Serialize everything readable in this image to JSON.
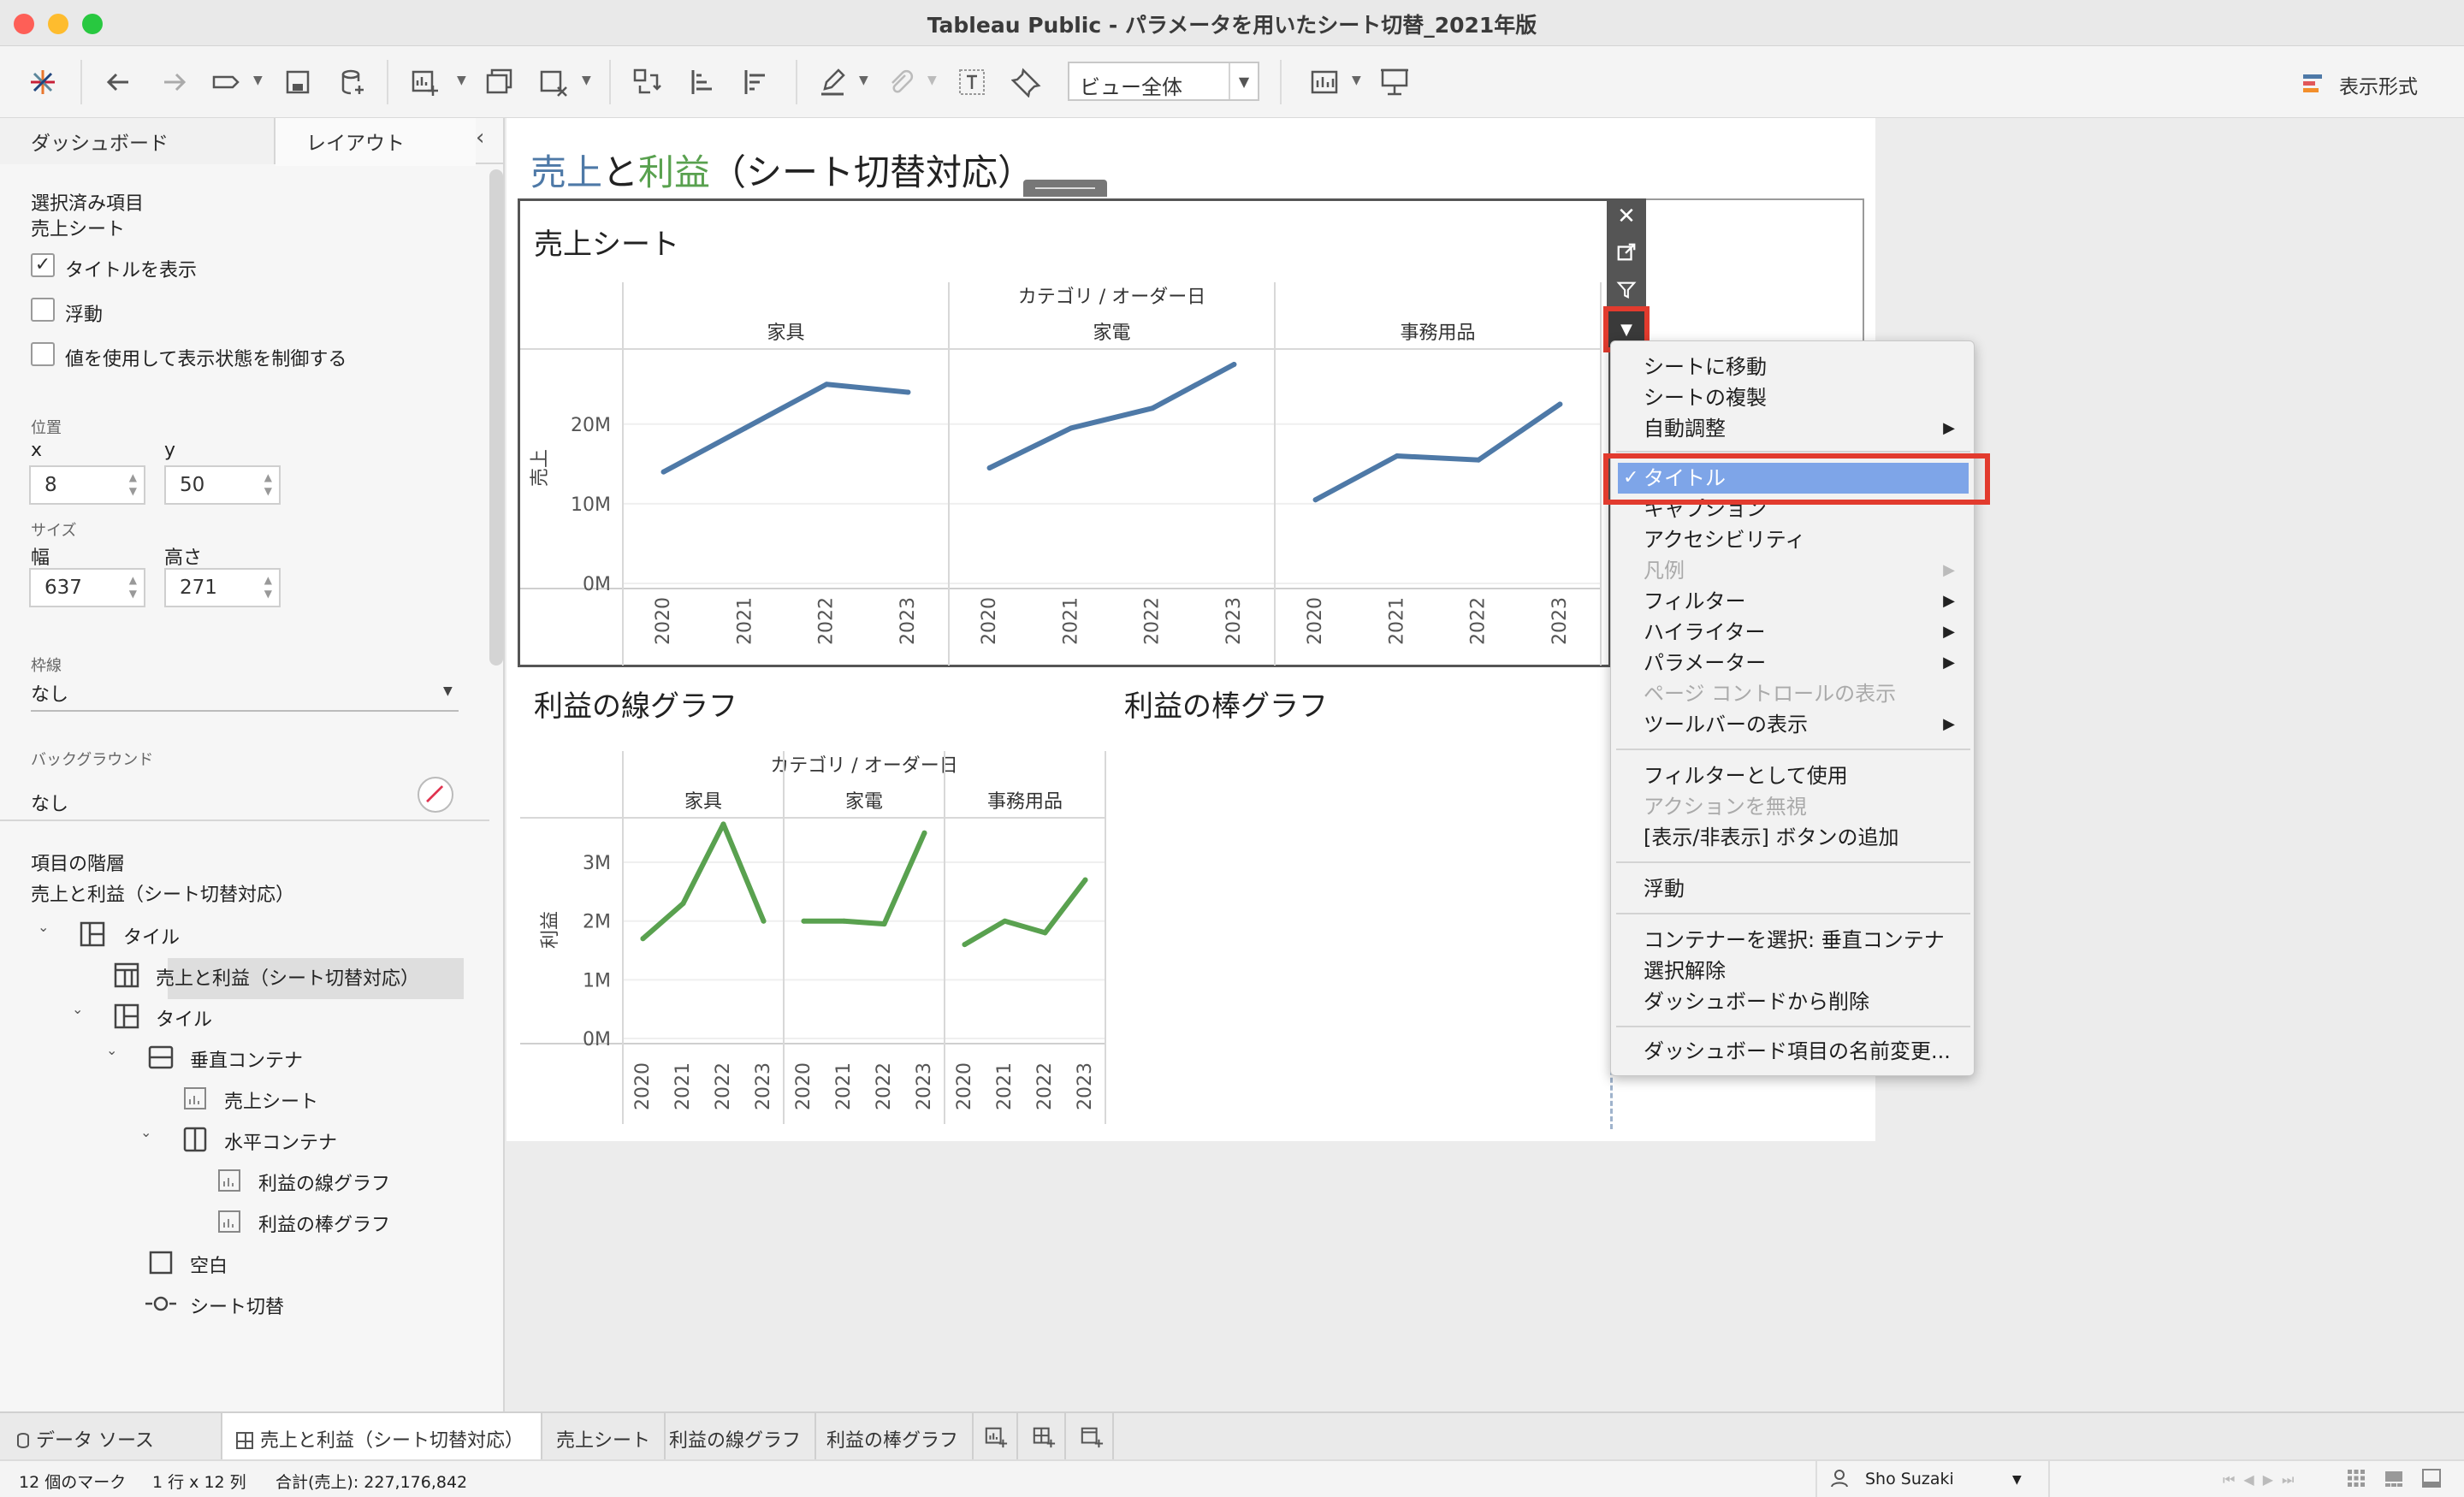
{
  "window": {
    "title": "Tableau Public - パラメータを用いたシート切替_2021年版"
  },
  "toolbar": {
    "view_mode": "ビュー全体",
    "show_me": "表示形式"
  },
  "left_panel": {
    "tab_dashboard": "ダッシュボード",
    "tab_layout": "レイアウト",
    "selected_label": "選択済み項目",
    "selected_item": "売上シート",
    "show_title": "タイトルを表示",
    "floating": "浮動",
    "control_visibility": "値を使用して表示状態を制御する",
    "position_label": "位置",
    "x_label": "x",
    "x_value": "8",
    "y_label": "y",
    "y_value": "50",
    "size_label": "サイズ",
    "width_label": "幅",
    "width_value": "637",
    "height_label": "高さ",
    "height_value": "271",
    "border_label": "枠線",
    "border_value": "なし",
    "background_label": "バックグラウンド",
    "background_value": "なし",
    "hierarchy_label": "項目の階層",
    "hierarchy_root": "売上と利益（シート切替対応）",
    "tree": [
      "タイル",
      "売上と利益（シート切替対応）",
      "タイル",
      "垂直コンテナ",
      "売上シート",
      "水平コンテナ",
      "利益の線グラフ",
      "利益の棒グラフ",
      "空白",
      "シート切替"
    ]
  },
  "dashboard": {
    "title_part1": "売上",
    "title_part2": "と",
    "title_part3": "利益",
    "title_part4": "（シート切替対応）",
    "sales_sheet_title": "売上シート",
    "profit_line_title": "利益の線グラフ",
    "profit_bar_title": "利益の棒グラフ"
  },
  "chart_data": [
    {
      "type": "line",
      "header": "カテゴリ / オーダー日",
      "ylabel": "売上",
      "panels": [
        "家具",
        "家電",
        "事務用品"
      ],
      "x": [
        "2020",
        "2021",
        "2022",
        "2023"
      ],
      "y_ticks": [
        "20M",
        "10M",
        "0M"
      ],
      "ylim": [
        0,
        29000000
      ],
      "series": [
        {
          "panel": "家具",
          "values": [
            14000000,
            19500000,
            25000000,
            24000000
          ]
        },
        {
          "panel": "家電",
          "values": [
            14500000,
            19500000,
            22000000,
            27500000
          ]
        },
        {
          "panel": "事務用品",
          "values": [
            10500000,
            16000000,
            15500000,
            22500000
          ]
        }
      ],
      "color": "#4e79a7"
    },
    {
      "type": "line",
      "header": "カテゴリ / オーダー日",
      "ylabel": "利益",
      "panels": [
        "家具",
        "家電",
        "事務用品"
      ],
      "x": [
        "2020",
        "2021",
        "2022",
        "2023"
      ],
      "y_ticks": [
        "3M",
        "2M",
        "1M",
        "0M"
      ],
      "ylim": [
        0,
        3700000
      ],
      "series": [
        {
          "panel": "家具",
          "values": [
            1700000,
            2300000,
            3650000,
            2000000
          ]
        },
        {
          "panel": "家電",
          "values": [
            2000000,
            2000000,
            1950000,
            3500000
          ]
        },
        {
          "panel": "事務用品",
          "values": [
            1600000,
            2000000,
            1800000,
            2700000
          ]
        }
      ],
      "color": "#59a14f"
    }
  ],
  "context_menu": {
    "items": [
      "シートに移動",
      "シートの複製",
      "自動調整",
      "タイトル",
      "キャプション",
      "アクセシビリティ",
      "凡例",
      "フィルター",
      "ハイライター",
      "パラメーター",
      "ページ コントロールの表示",
      "ツールバーの表示",
      "フィルターとして使用",
      "アクションを無視",
      "[表示/非表示] ボタンの追加",
      "浮動",
      "コンテナーを選択: 垂直コンテナ",
      "選択解除",
      "ダッシュボードから削除",
      "ダッシュボード項目の名前変更..."
    ]
  },
  "bottom_tabs": {
    "data_source": "データ ソース",
    "dashboard": "売上と利益（シート切替対応）",
    "sheet1": "売上シート",
    "sheet2": "利益の線グラフ",
    "sheet3": "利益の棒グラフ"
  },
  "status": {
    "marks": "12 個のマーク",
    "dims": "1 行 x 12 列",
    "sum": "合計(売上): 227,176,842",
    "user": "Sho Suzaki"
  }
}
